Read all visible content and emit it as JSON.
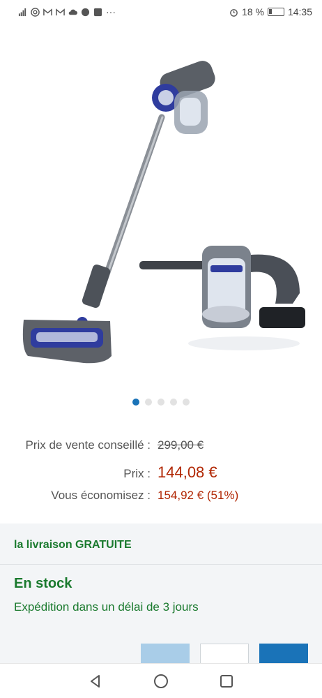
{
  "status_bar": {
    "left_icons": [
      "signal-icon",
      "wifi-icon",
      "gmail-icon",
      "gmail-icon",
      "cloud-icon",
      "app-icon",
      "app-icon",
      "more-icon"
    ],
    "more": "···",
    "battery_percent": "18 %",
    "time": "14:35"
  },
  "carousel": {
    "total": 5,
    "active_index": 0
  },
  "pricing": {
    "srp_label": "Prix de vente conseillé :",
    "srp_value": "299,00 €",
    "price_label": "Prix :",
    "price_value": "144,08 €",
    "savings_label": "Vous économisez :",
    "savings_value": "154,92 € (51%)"
  },
  "delivery": {
    "free_delivery": "la livraison GRATUITE",
    "stock": "En stock",
    "shipping": "Expédition dans un délai de 3 jours"
  },
  "colors": {
    "accent": "#1a73b8",
    "price_red": "#b12704",
    "stock_green": "#1a7a2e"
  },
  "nav": {
    "icons": [
      "back-icon",
      "home-icon",
      "recents-icon"
    ]
  }
}
